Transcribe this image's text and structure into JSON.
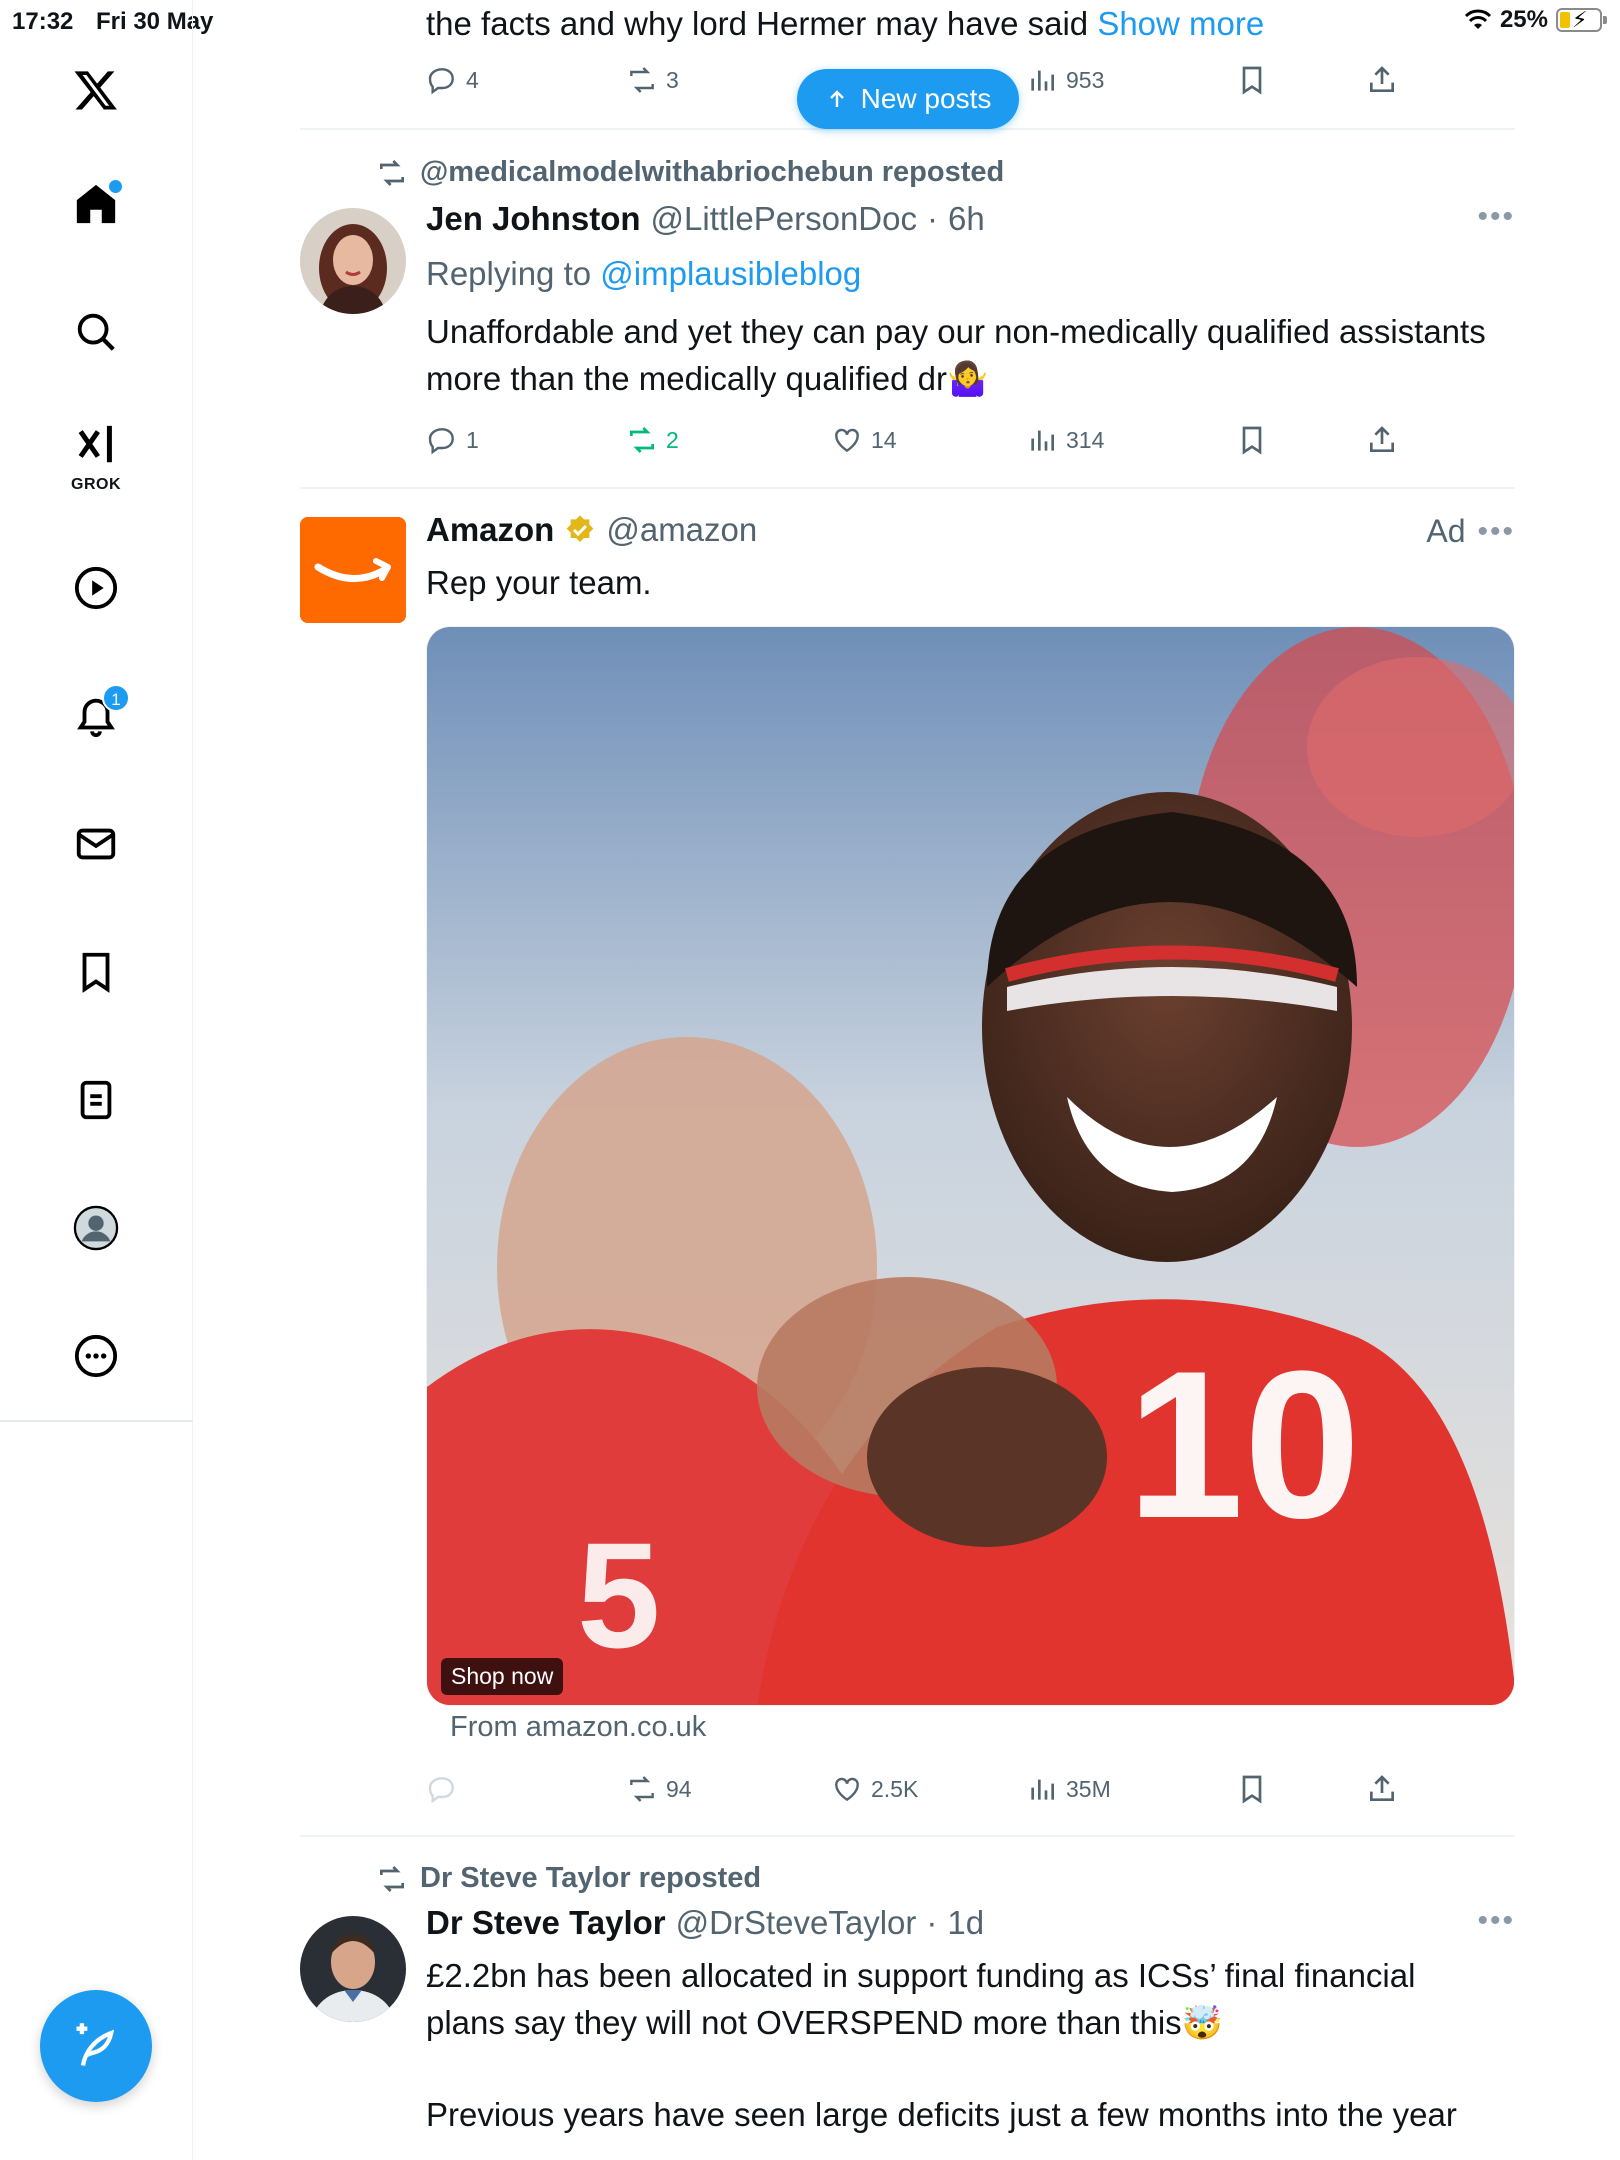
{
  "status_bar": {
    "time": "17:32",
    "date": "Fri 30 May",
    "battery": "25%"
  },
  "sidebar": {
    "grok_label": "GROK",
    "notifications_badge": "1"
  },
  "new_posts_label": "New posts",
  "tweets": [
    {
      "text_prefix": "the facts and why lord Hermer may have said",
      "show_more": "Show more",
      "replies": "4",
      "reposts": "3",
      "views": "953"
    },
    {
      "repost_by": "@medicalmodelwithabriochebun reposted",
      "name": "Jen Johnston",
      "handle": "@LittlePersonDoc",
      "time": "6h",
      "replying_label": "Replying to",
      "replying_to": "@implausibleblog",
      "text": "Unaffordable and yet they can pay our non-medically qualified assistants more than the medically qualified dr🤷‍♀️",
      "replies": "1",
      "reposts": "2",
      "likes": "14",
      "views": "314"
    },
    {
      "name": "Amazon",
      "handle": "@amazon",
      "ad_label": "Ad",
      "text": "Rep your team.",
      "shop_now": "Shop now",
      "from": "From amazon.co.uk",
      "reposts": "94",
      "likes": "2.5K",
      "views": "35M"
    },
    {
      "repost_by": "Dr Steve Taylor reposted",
      "name": "Dr Steve Taylor",
      "handle": "@DrSteveTaylor",
      "time": "1d",
      "text_line1": "£2.2bn has been allocated in support funding as ICSs’ final financial",
      "text_line2": "plans say they will not OVERSPEND more than this🤯",
      "text_line3": "Previous years have seen large deficits just a few months into the year"
    }
  ],
  "colors": {
    "accent": "#1d9bf0",
    "repost_green": "#00ba7c",
    "muted": "#536471",
    "amazon_orange": "#ff6a00"
  }
}
